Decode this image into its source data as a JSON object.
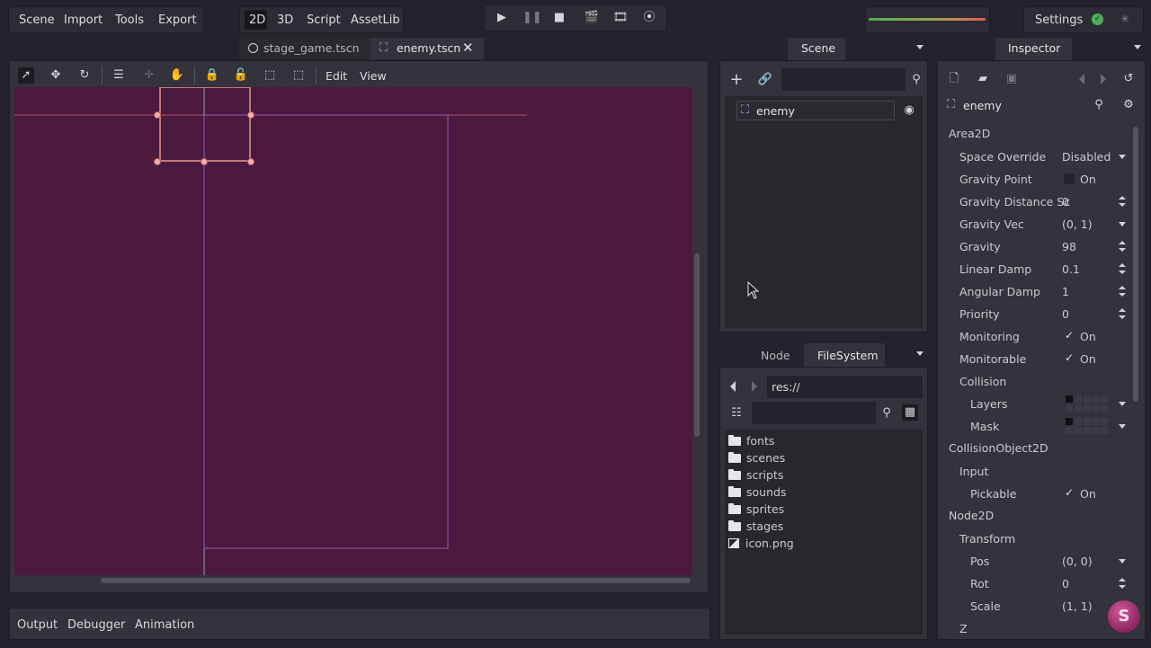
{
  "menu": {
    "scene": "Scene",
    "import": "Import",
    "tools": "Tools",
    "export": "Export"
  },
  "workspaces": {
    "two_d": "2D",
    "three_d": "3D",
    "script": "Script",
    "assetlib": "AssetLib"
  },
  "settings_label": "Settings",
  "tabs": {
    "stage_game": "stage_game.tscn",
    "enemy": "enemy.tscn"
  },
  "viewport_menu": {
    "edit": "Edit",
    "view": "View"
  },
  "scene_dock": {
    "tab_label": "Scene",
    "root_node": "enemy"
  },
  "lower_dock": {
    "node_tab": "Node",
    "filesystem_tab": "FileSystem",
    "path": "res://",
    "items": [
      {
        "name": "fonts",
        "type": "folder"
      },
      {
        "name": "scenes",
        "type": "folder"
      },
      {
        "name": "scripts",
        "type": "folder"
      },
      {
        "name": "sounds",
        "type": "folder"
      },
      {
        "name": "sprites",
        "type": "folder"
      },
      {
        "name": "stages",
        "type": "folder"
      },
      {
        "name": "icon.png",
        "type": "image"
      }
    ]
  },
  "inspector": {
    "tab_label": "Inspector",
    "node_name": "enemy",
    "section_area2d": "Area2D",
    "section_collisionobject2d": "CollisionObject2D",
    "section_node2d": "Node2D",
    "props": {
      "space_override_label": "Space Override",
      "space_override_value": "Disabled",
      "gravity_point_label": "Gravity Point",
      "gravity_point_value": "On",
      "gravity_distance_label": "Gravity Distance Sc",
      "gravity_distance_value": "0",
      "gravity_vec_label": "Gravity Vec",
      "gravity_vec_value": "(0, 1)",
      "gravity_label": "Gravity",
      "gravity_value": "98",
      "linear_damp_label": "Linear Damp",
      "linear_damp_value": "0.1",
      "angular_damp_label": "Angular Damp",
      "angular_damp_value": "1",
      "priority_label": "Priority",
      "priority_value": "0",
      "monitoring_label": "Monitoring",
      "monitoring_value": "On",
      "monitorable_label": "Monitorable",
      "monitorable_value": "On",
      "collision_label": "Collision",
      "layers_label": "Layers",
      "mask_label": "Mask",
      "input_label": "Input",
      "pickable_label": "Pickable",
      "pickable_value": "On",
      "transform_label": "Transform",
      "pos_label": "Pos",
      "pos_value": "(0, 0)",
      "rot_label": "Rot",
      "rot_value": "0",
      "scale_label": "Scale",
      "scale_value": "(1, 1)",
      "z_label": "Z"
    }
  },
  "bottom_panel": {
    "output": "Output",
    "debugger": "Debugger",
    "animation": "Animation"
  },
  "colors": {
    "viewport_bg": "#4b1a3e",
    "accent": "#6b93c4",
    "collision_shape": "#e79a88"
  }
}
